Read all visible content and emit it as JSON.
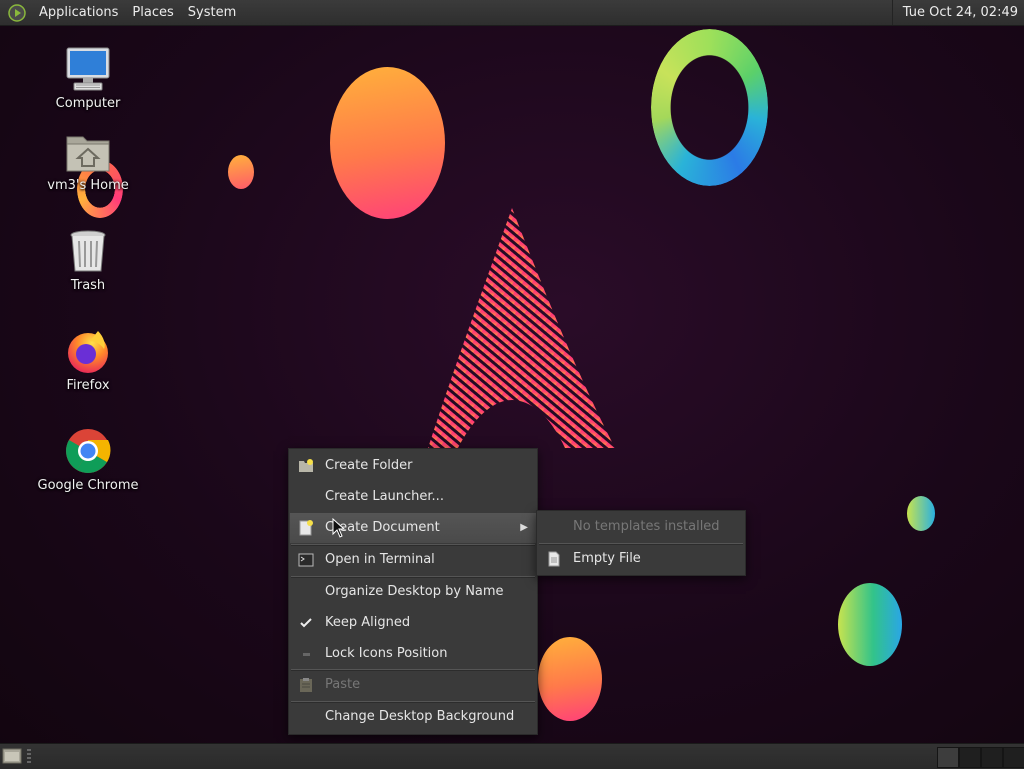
{
  "top_panel": {
    "menus": [
      "Applications",
      "Places",
      "System"
    ],
    "clock": "Tue Oct 24, 02:49",
    "logo_icon": "menu-logo-icon"
  },
  "desktop_icons": [
    {
      "label": "Computer",
      "icon": "computer-icon"
    },
    {
      "label": "vm3's Home",
      "icon": "home-folder-icon"
    },
    {
      "label": "Trash",
      "icon": "trash-icon"
    },
    {
      "label": "Firefox",
      "icon": "firefox-icon"
    },
    {
      "label": "Google Chrome",
      "icon": "chrome-icon"
    }
  ],
  "context_menu": {
    "items": [
      {
        "label": "Create Folder",
        "icon": "new-folder-icon"
      },
      {
        "label": "Create Launcher...",
        "icon": ""
      },
      {
        "label": "Create Document",
        "icon": "new-document-icon",
        "submenu": true,
        "highlighted": true
      },
      {
        "label": "Open in Terminal",
        "icon": "terminal-icon"
      },
      {
        "label": "Organize Desktop by Name",
        "icon": ""
      },
      {
        "label": "Keep Aligned",
        "icon": "checkmark-icon",
        "checked": true
      },
      {
        "label": "Lock Icons Position",
        "icon": "unchecked-box-icon",
        "checked": false
      },
      {
        "label": "Paste",
        "icon": "paste-icon",
        "disabled": true
      },
      {
        "label": "Change Desktop Background",
        "icon": ""
      }
    ]
  },
  "submenu": {
    "items": [
      {
        "label": "No templates installed",
        "disabled": true
      },
      {
        "label": "Empty File",
        "icon": "text-file-icon"
      }
    ]
  },
  "colors": {
    "panel_bg": "#2e2e2e",
    "menu_bg": "#3a3a3a",
    "desktop_bg": "#1a0719",
    "accent_orange": "#ff7a4a",
    "accent_pink": "#ff3f7a",
    "accent_green": "#9ee05a",
    "accent_blue": "#2b7be6"
  }
}
